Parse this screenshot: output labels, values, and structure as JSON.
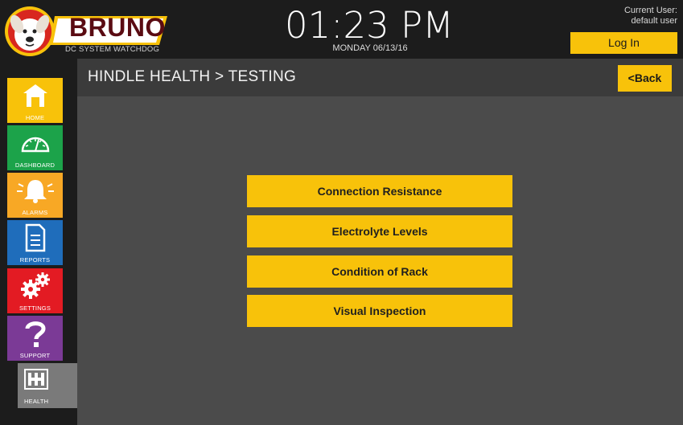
{
  "brand": {
    "name": "BRUNO",
    "subtitle": "DC SYSTEM WATCHDOG"
  },
  "clock": {
    "time": "01:23 PM",
    "date": "MONDAY 06/13/16"
  },
  "user": {
    "label": "Current User:",
    "name": "default user",
    "login_label": "Log In"
  },
  "nav": {
    "home": "HOME",
    "dashboard": "DASHBOARD",
    "alarms": "ALARMS",
    "reports": "REPORTS",
    "settings": "SETTINGS",
    "support": "SUPPORT",
    "health": "HEALTH"
  },
  "page": {
    "title": "HINDLE HEALTH > TESTING",
    "back_label": "<Back"
  },
  "tests": [
    {
      "label": "Connection Resistance"
    },
    {
      "label": "Electrolyte Levels"
    },
    {
      "label": "Condition of Rack"
    },
    {
      "label": "Visual Inspection"
    }
  ],
  "colors": {
    "accent": "#f8c20a",
    "home": "#f8c20a",
    "dashboard": "#1ca34a",
    "alarms": "#f8a825",
    "reports": "#1f6dbb",
    "settings": "#e31b23",
    "support": "#7b3a96",
    "health": "#7a7a7a"
  },
  "icons": {
    "home": "house-icon",
    "dashboard": "gauge-icon",
    "alarms": "bell-icon",
    "reports": "document-icon",
    "settings": "gears-icon",
    "support": "question-icon",
    "health": "hindle-logo-icon"
  }
}
